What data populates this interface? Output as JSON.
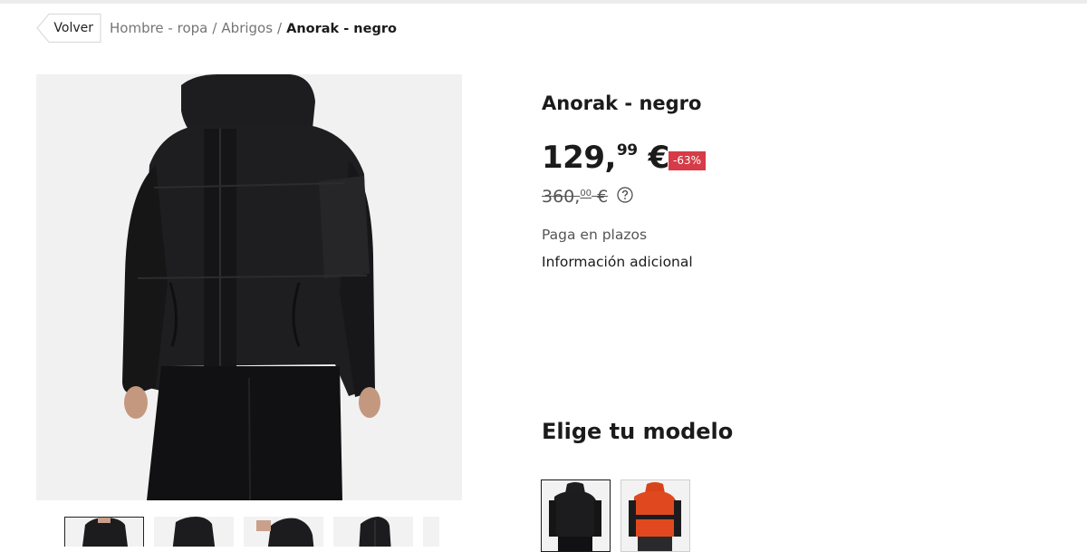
{
  "breadcrumb": {
    "back_label": "Volver",
    "items": [
      "Hombre - ropa",
      "Abrigos"
    ],
    "current": "Anorak - negro"
  },
  "product": {
    "title": "Anorak - negro",
    "price_int": "129,",
    "price_dec": "99",
    "currency": "€",
    "discount": "-63%",
    "old_price_int": "360,",
    "old_price_dec": "00",
    "installments": "Paga en plazos",
    "more_info": "Información adicional"
  },
  "models": {
    "title": "Elige tu modelo",
    "options": [
      {
        "color": "negro",
        "selected": true
      },
      {
        "color": "naranja",
        "selected": false
      }
    ]
  },
  "gallery": {
    "thumbnail_count": 5,
    "active_thumbnail": 1
  },
  "colors": {
    "discount_bg": "#d63b47",
    "jacket_black": "#1c1c1e",
    "jacket_orange": "#e0491f"
  }
}
